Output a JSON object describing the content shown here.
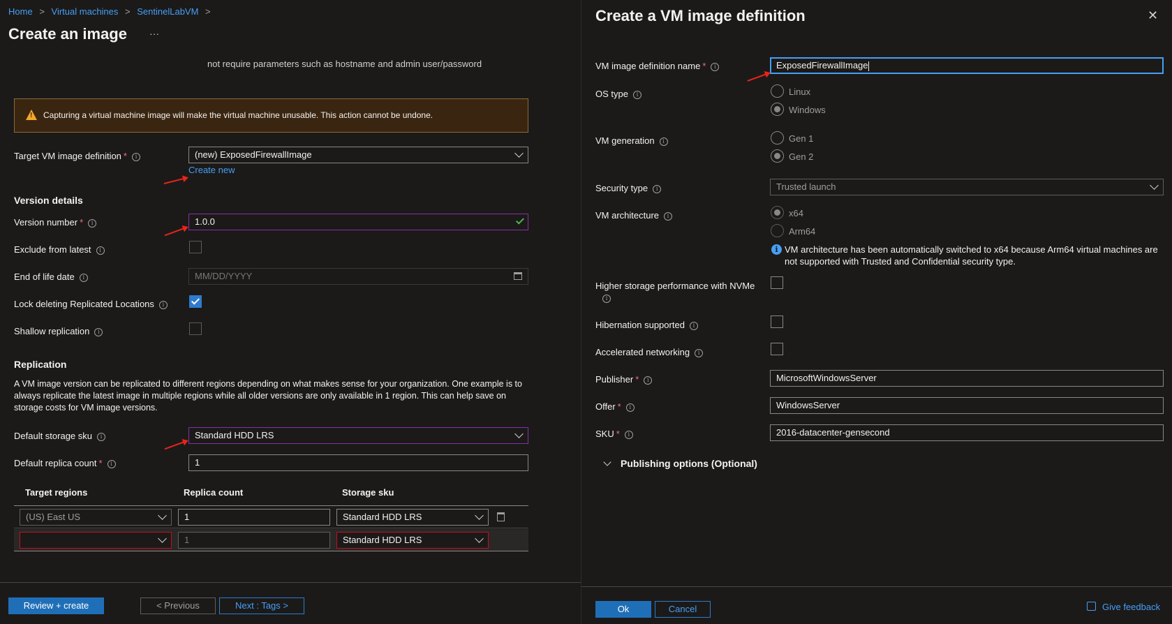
{
  "breadcrumb": [
    "Home",
    "Virtual machines",
    "SentinelLabVM"
  ],
  "left": {
    "title": "Create an image",
    "ellipsis": "···",
    "truncated_text": "not require parameters such as hostname and admin user/password",
    "warning": "Capturing a virtual machine image will make the virtual machine unusable. This action cannot be undone.",
    "target_def_label": "Target VM image definition",
    "target_def_value": "(new) ExposedFirewallImage",
    "create_new": "Create new",
    "version_details": "Version details",
    "version_number_label": "Version number",
    "version_number_value": "1.0.0",
    "exclude_label": "Exclude from latest",
    "eol_label": "End of life date",
    "eol_placeholder": "MM/DD/YYYY",
    "lock_label": "Lock deleting Replicated Locations",
    "shallow_label": "Shallow replication",
    "replication_heading": "Replication",
    "replication_desc": "A VM image version can be replicated to different regions depending on what makes sense for your organization. One example is to always replicate the latest image in multiple regions while all older versions are only available in 1 region. This can help save on storage costs for VM image versions.",
    "default_sku_label": "Default storage sku",
    "default_sku_value": "Standard HDD LRS",
    "replica_count_label": "Default replica count",
    "replica_count_value": "1",
    "table_headers": [
      "Target regions",
      "Replica count",
      "Storage sku"
    ],
    "rows": [
      {
        "region": "(US) East US",
        "count": "1",
        "sku": "Standard HDD LRS"
      },
      {
        "region": "",
        "count": "1",
        "sku": "Standard HDD LRS"
      }
    ],
    "review_button": "Review + create",
    "prev_button": "< Previous",
    "next_button": "Next : Tags >"
  },
  "right": {
    "title": "Create a VM image definition",
    "def_name_label": "VM image definition name",
    "def_name_value": "ExposedFirewallImage",
    "os_type_label": "OS type",
    "os_options": [
      "Linux",
      "Windows"
    ],
    "vm_gen_label": "VM generation",
    "gen_options": [
      "Gen 1",
      "Gen 2"
    ],
    "security_label": "Security type",
    "security_value": "Trusted launch",
    "arch_label": "VM architecture",
    "arch_options": [
      "x64",
      "Arm64"
    ],
    "arch_info": "VM architecture has been automatically switched to x64 because Arm64 virtual machines are not supported with Trusted and Confidential security type.",
    "nvme_label": "Higher storage performance with NVMe",
    "hibernation_label": "Hibernation supported",
    "accel_label": "Accelerated networking",
    "publisher_label": "Publisher",
    "publisher_value": "MicrosoftWindowsServer",
    "offer_label": "Offer",
    "offer_value": "WindowsServer",
    "sku_label": "SKU",
    "sku_value": "2016-datacenter-gensecond",
    "publishing_options": "Publishing options (Optional)",
    "ok_button": "Ok",
    "cancel_button": "Cancel",
    "feedback": "Give feedback"
  }
}
